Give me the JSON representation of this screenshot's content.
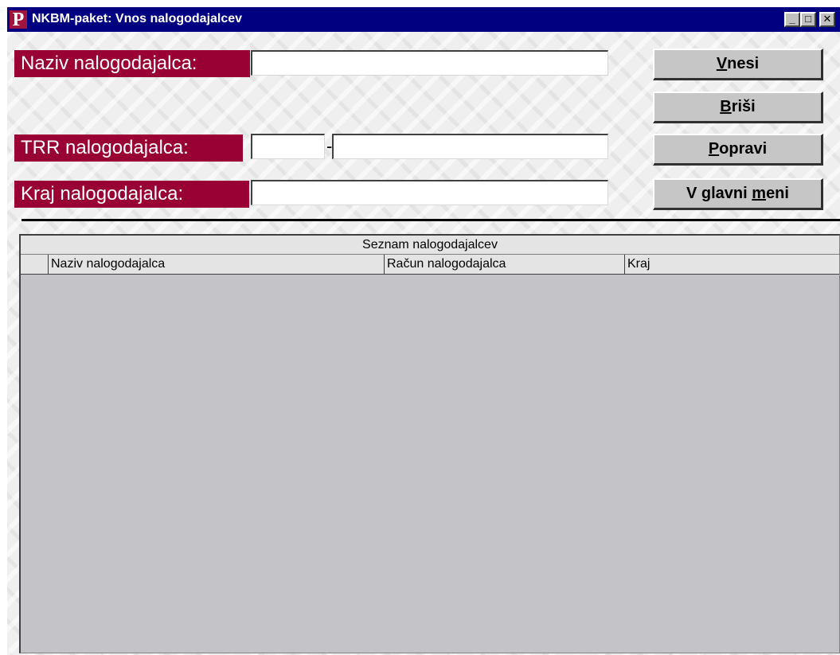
{
  "window": {
    "title": "NKBM-paket: Vnos nalogodajalcev",
    "icon_letter": "P",
    "controls": {
      "minimize": "_",
      "maximize": "□",
      "close": "✕"
    }
  },
  "form": {
    "naziv_label": "Naziv nalogodajalca:",
    "naziv_value": "",
    "trr_label": "TRR nalogodajalca:",
    "trr_bank_value": "",
    "trr_separator": "-",
    "trr_account_value": "",
    "kraj_label": "Kraj nalogodajalca:",
    "kraj_value": ""
  },
  "buttons": {
    "vnesi": {
      "hotkey": "V",
      "rest": "nesi"
    },
    "brisi": {
      "hotkey": "B",
      "rest": "riši"
    },
    "popravi": {
      "hotkey": "P",
      "rest": "opravi"
    },
    "glavni_meni": {
      "prefix": "V glavni ",
      "hotkey": "m",
      "rest": "eni"
    }
  },
  "grid": {
    "caption": "Seznam nalogodajalcev",
    "columns": [
      "Naziv nalogodajalca",
      "Račun nalogodajalca",
      "Kraj"
    ],
    "rows": []
  },
  "colors": {
    "titlebar": "#000080",
    "label_background": "#990033",
    "grid_background": "#c4c3c7"
  }
}
